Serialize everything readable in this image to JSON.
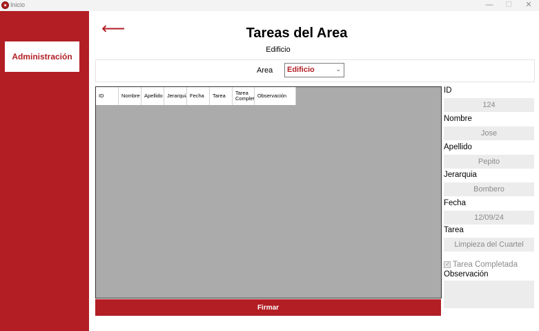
{
  "window": {
    "title": "Inicio",
    "min_glyph": "—",
    "max_glyph": "☐",
    "close_glyph": "✕"
  },
  "sidebar": {
    "items": [
      {
        "label": "Administración"
      }
    ]
  },
  "header": {
    "back_glyph": "⟵",
    "title": "Tareas del Area",
    "subtitle": "Edificio"
  },
  "filter": {
    "area_label": "Area",
    "area_value": "Edificio"
  },
  "grid": {
    "columns": [
      "ID",
      "Nombre",
      "Apellido",
      "Jerarquia",
      "Fecha",
      "Tarea",
      "Tarea Completa",
      "Observación"
    ]
  },
  "actions": {
    "sign_label": "Firmar"
  },
  "details": {
    "id_label": "ID",
    "id_value": "124",
    "nombre_label": "Nombre",
    "nombre_value": "Jose",
    "apellido_label": "Apellido",
    "apellido_value": "Pepito",
    "jerarquia_label": "Jerarquia",
    "jerarquia_value": "Bombero",
    "fecha_label": "Fecha",
    "fecha_value": "12/09/24",
    "tarea_label": "Tarea",
    "tarea_value": "Limpieza del Cuartel",
    "completada_label": "Tarea Completada",
    "completada_checked": true,
    "observacion_label": "Observación",
    "observacion_value": ""
  },
  "colors": {
    "accent": "#b21e24",
    "grid_bg": "#ababab",
    "field_bg": "#ececec"
  }
}
